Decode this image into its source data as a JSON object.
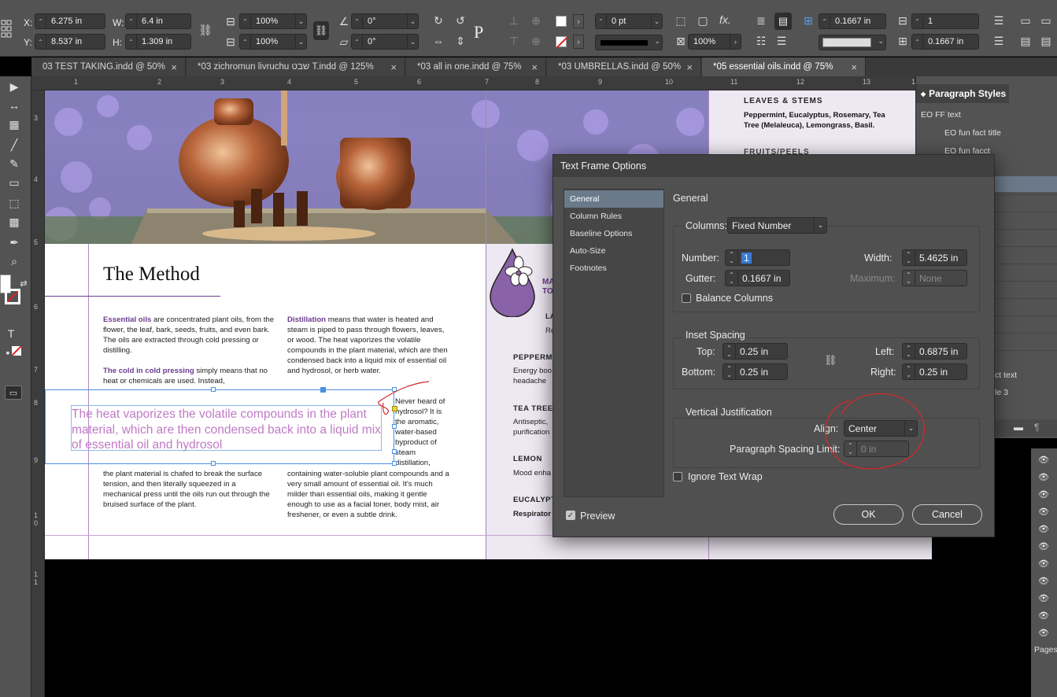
{
  "control_bar": {
    "x_label": "X:",
    "x_value": "6.275 in",
    "y_label": "Y:",
    "y_value": "8.537 in",
    "w_label": "W:",
    "w_value": "6.4 in",
    "h_label": "H:",
    "h_value": "1.309 in",
    "scale_x": "100%",
    "scale_y": "100%",
    "rotation": "0°",
    "shear": "0°",
    "stroke_weight": "0 pt",
    "opacity": "100%",
    "gutter_1": "0.1667 in",
    "gutter_2": "0.1667 in",
    "columns_value": "1"
  },
  "tabs": [
    {
      "label": "03 TEST TAKING.indd @ 50%"
    },
    {
      "label": "*03  zichromun  livruchu שבט T.indd @ 125%"
    },
    {
      "label": "*03 all in one.indd @ 75%"
    },
    {
      "label": "*03 UMBRELLAS.indd @ 50%"
    },
    {
      "label": "*05 essential oils.indd @ 75%"
    }
  ],
  "ruler": {
    "ticks": [
      "1",
      "2",
      "3",
      "4",
      "5",
      "6",
      "7",
      "8",
      "9",
      "10",
      "11",
      "12",
      "13",
      "14"
    ],
    "v_ticks": [
      "3",
      "4",
      "5",
      "6",
      "7",
      "8",
      "9",
      "1 0",
      "1 1"
    ]
  },
  "document": {
    "heading": "The Method",
    "col1_p1_lead": "Essential oils",
    "col1_p1_rest": " are concentrated plant oils, from the flower, the leaf, bark, seeds, fruits, and even bark. The oils are extracted through cold pressing or distilling.",
    "col1_p2_lead": "The cold in cold pressing",
    "col1_p2_rest": " simply means that no heat or chemicals are used. Instead,",
    "col1_p3": "the plant material is chafed to break the surface tension, and then literally squeezed in a mechanical press until the oils run out through the bruised surface of the plant.",
    "col2_p1_lead": "Distillation",
    "col2_p1_rest": " means that water is heated and steam is piped to pass through flowers, leaves, or wood. The heat vaporizes the volatile compounds in the plant material, which are then condensed back into a liquid mix of essential oil and hydrosol, or herb water.",
    "col2_side": "Never heard of hydrosol? It is the aromatic, water-based byproduct of steam distillation,",
    "col2_p2": "containing water-soluble plant compounds and a very small amount of essential oil. It's much milder than essential oils, making it gentle enough to use as a facial toner, body mist, air freshener, or even a subtle drink.",
    "pull_quote": "The heat vaporizes the volatile compounds in the plant material, which are then condensed back into a liquid mix of essential oil and hydrosol",
    "right_title_partial": "MA\nTO",
    "right_la": "LA",
    "right_re": "Re",
    "leaves_stems_title": "LEAVES & STEMS",
    "leaves_stems_text": "Peppermint, Eucalyptus, Rosemary, Tea Tree (Melaleuca), Lemongrass, Basil.",
    "fruits_peels_title": "FRUITS/PEELS",
    "peppermint_title": "PEPPERM",
    "peppermint_text": "Energy boo\nheadache",
    "tea_tree_title": "TEA TREE",
    "tea_tree_text": "Antiseptic,\npurification",
    "lemon_title": "LEMON",
    "lemon_text": "Mood enha",
    "eucalyptus_title": "EUCALYPT",
    "eucalyptus_text": "Respirator"
  },
  "paragraph_styles": {
    "title": "Paragraph Styles",
    "items": [
      "EO FF text",
      "EO fun fact title",
      "EO fun facct"
    ],
    "partial_items": [
      "ct text",
      "le 3"
    ],
    "footer_label": "Pages"
  },
  "dialog": {
    "title": "Text Frame Options",
    "nav": [
      "General",
      "Column Rules",
      "Baseline Options",
      "Auto-Size",
      "Footnotes"
    ],
    "section_title": "General",
    "columns_label": "Columns:",
    "columns_value": "Fixed Number",
    "number_label": "Number:",
    "number_value": "1",
    "gutter_label": "Gutter:",
    "gutter_value": "0.1667 in",
    "width_label": "Width:",
    "width_value": "5.4625 in",
    "maximum_label": "Maximum:",
    "maximum_value": "None",
    "balance_label": "Balance Columns",
    "inset_title": "Inset Spacing",
    "top_label": "Top:",
    "top_value": "0.25 in",
    "bottom_label": "Bottom:",
    "bottom_value": "0.25 in",
    "left_label": "Left:",
    "left_value": "0.6875 in",
    "right_label": "Right:",
    "right_value": "0.25 in",
    "vj_title": "Vertical Justification",
    "align_label": "Align:",
    "align_value": "Center",
    "psl_label": "Paragraph Spacing Limit:",
    "psl_value": "0 in",
    "ignore_wrap_label": "Ignore Text Wrap",
    "preview_label": "Preview",
    "ok_label": "OK",
    "cancel_label": "Cancel"
  }
}
